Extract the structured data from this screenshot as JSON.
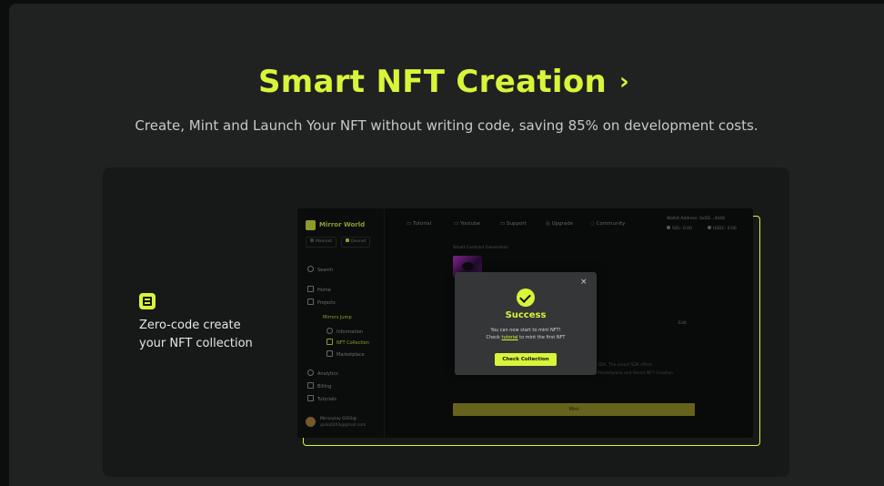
{
  "hero": {
    "title": "Smart NFT Creation",
    "chevron": "›",
    "subtitle": "Create, Mint and Launch Your NFT without writing code, saving 85% on development costs."
  },
  "feature": {
    "icon": "layers-icon",
    "line1": "Zero-code create",
    "line2": "your NFT collection"
  },
  "app": {
    "brand": "Mirror World",
    "networks": [
      "Mainnet",
      "Devnet"
    ],
    "sidebar": {
      "search": "Search",
      "home": "Home",
      "projects": "Projects",
      "project_name": "Mirrors Jump",
      "information": "Information",
      "nft_collection": "NFT Collection",
      "marketplace": "Marketplace",
      "analytics": "Analytics",
      "billing": "Billing",
      "tutorials": "Tutorials"
    },
    "user": {
      "name": "Mirrorplay 0203@",
      "email": "gallo0203@gmail.com"
    },
    "topnav": [
      "Tutorial",
      "Youtube",
      "Support",
      "Upgrade",
      "Community"
    ],
    "wallet": "Wallet Address: 0x0D...4d48",
    "balances": [
      "SOL: 0.00",
      "USDC: 0.00"
    ],
    "breadcrumb": "Smart Contract Generation",
    "edit": "Edit",
    "bg_text1": "SDK. The smart SDK offers",
    "bg_text2": "Marketplace and Smart NFT Creation",
    "mint_button": "Mint"
  },
  "modal": {
    "title": "Success",
    "line1": "You can now start to mint NFT!",
    "line2_pre": "Check ",
    "line2_link": "tutorial",
    "line2_post": " to mint the first NFT",
    "button": "Check Collection",
    "close": "×"
  },
  "colors": {
    "accent": "#d9f53a",
    "panel": "#202121",
    "card": "#171818"
  }
}
